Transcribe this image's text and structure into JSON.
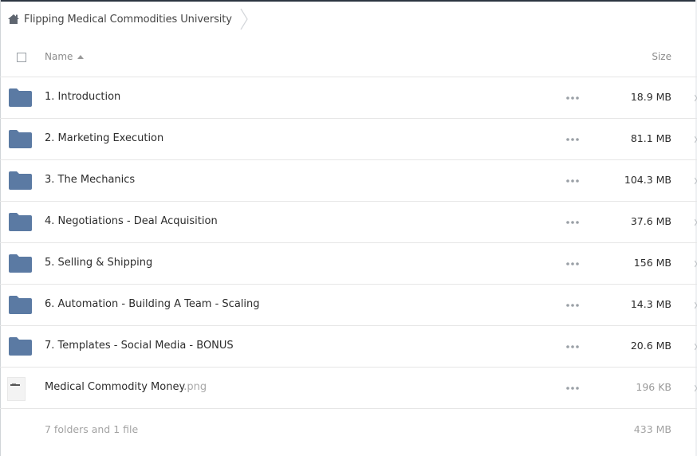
{
  "breadcrumb": {
    "home_icon": "home-icon",
    "current": "Flipping Medical Commodities University"
  },
  "table": {
    "header": {
      "name": "Name",
      "size": "Size",
      "sort": "ascending"
    },
    "rows": [
      {
        "name": "1. Introduction",
        "ext": "",
        "size": "18.9 MB",
        "type": "folder"
      },
      {
        "name": "2. Marketing Execution",
        "ext": "",
        "size": "81.1 MB",
        "type": "folder"
      },
      {
        "name": "3. The Mechanics",
        "ext": "",
        "size": "104.3 MB",
        "type": "folder"
      },
      {
        "name": "4. Negotiations - Deal Acquisition",
        "ext": "",
        "size": "37.6 MB",
        "type": "folder"
      },
      {
        "name": "5. Selling & Shipping",
        "ext": "",
        "size": "156 MB",
        "type": "folder"
      },
      {
        "name": "6. Automation - Building A Team - Scaling",
        "ext": "",
        "size": "14.3 MB",
        "type": "folder"
      },
      {
        "name": "7. Templates - Social Media - BONUS",
        "ext": "",
        "size": "20.6 MB",
        "type": "folder"
      },
      {
        "name": "Medical Commodity Money",
        "ext": ".png",
        "size": "196 KB",
        "type": "file"
      }
    ]
  },
  "footer": {
    "summary": "7 folders and 1 file",
    "total": "433 MB"
  },
  "colors": {
    "folder": "#5b7aa3",
    "accent_border": "#2b3440"
  }
}
